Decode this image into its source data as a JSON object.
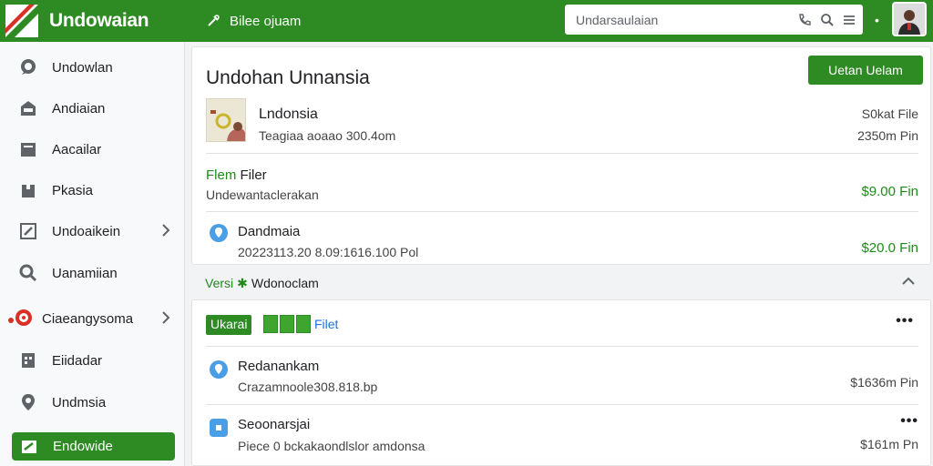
{
  "app": {
    "name": "Undowaian",
    "breadcrumb": "Bilee ojuam"
  },
  "search": {
    "placeholder": "Undarsaulaian"
  },
  "sidebar": {
    "items": [
      {
        "label": "Undowlan",
        "icon": "chat-bubble-icon"
      },
      {
        "label": "Andiaian",
        "icon": "inbox-icon"
      },
      {
        "label": "Aacailar",
        "icon": "folder-icon"
      },
      {
        "label": "Pkasia",
        "icon": "archive-box-icon"
      },
      {
        "label": "Undoaikein",
        "icon": "edit-icon",
        "chevron": true
      },
      {
        "label": "Uanamiian",
        "icon": "search-icon"
      },
      {
        "label": "Ciaeangysoma",
        "icon": "notification-bubble-icon",
        "chevron": true
      },
      {
        "label": "Eiidadar",
        "icon": "document-icon"
      },
      {
        "label": "Undmsia",
        "icon": "location-pin-icon"
      },
      {
        "label": "Endowide",
        "icon": "note-icon",
        "active": true
      }
    ]
  },
  "main": {
    "title": "Undohan Unnansia",
    "primary_button": "Uetan Uelam",
    "rows": [
      {
        "title": "Lndonsia",
        "sub": "Teagiaa aoaao 300.4om",
        "right_top": "S0kat File",
        "right_bottom": "2350m Pin"
      },
      {
        "title_prefix": "Flem",
        "title": "Filer",
        "sub": "Undewantaclerakan",
        "right": "$9.00 Fin"
      },
      {
        "title": "Dandmaia",
        "sub": "20223113.20 8.09:1616.100 Pol",
        "right": "$20.0 Fin"
      }
    ],
    "section": {
      "prefix": "Versi",
      "label": "Wdonoclam"
    },
    "card2": {
      "badge": "Ukarai",
      "filter": "Filet",
      "rows": [
        {
          "title": "Redanankam",
          "sub": "Crazamnoole308.818.bp",
          "right": "$1636m Pin"
        },
        {
          "title": "Seoonarsjai",
          "sub": "Piece 0 bckakaondlslor amdonsa",
          "right": "$161m Pn"
        }
      ]
    }
  },
  "colors": {
    "brand": "#2e8b23",
    "accent_green_text": "#1e8a1a",
    "link": "#1a73e8",
    "pin_blue": "#4a9ee6"
  }
}
